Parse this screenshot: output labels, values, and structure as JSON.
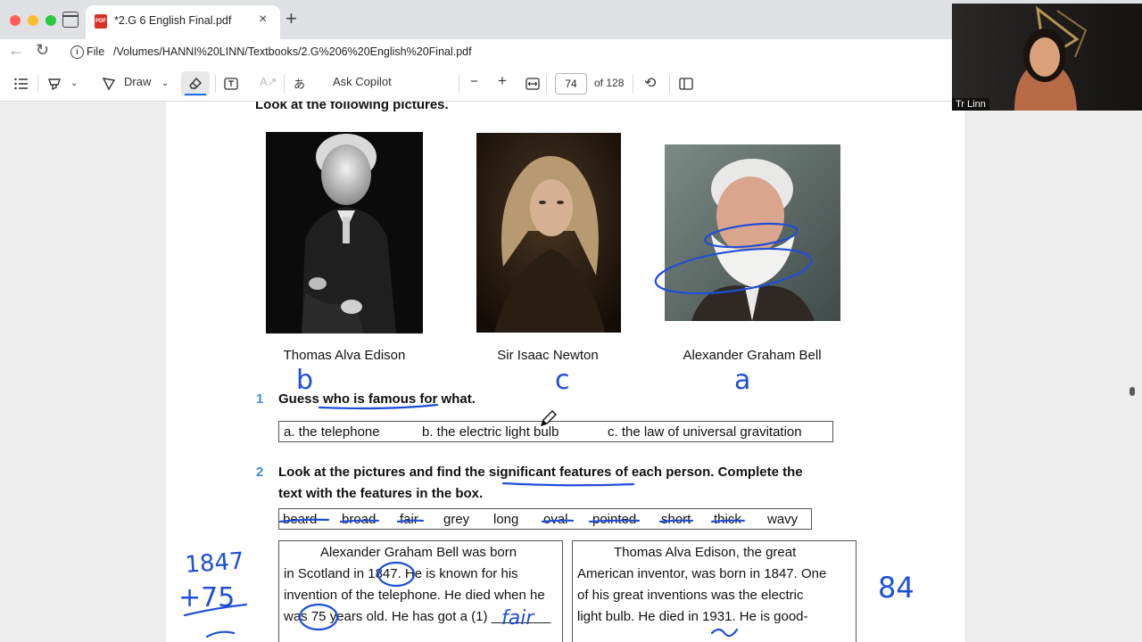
{
  "browser": {
    "tab_title": "*2.G 6 English Final.pdf",
    "tab_close": "×",
    "new_tab": "+",
    "file_label": "File",
    "url": "/Volumes/HANNI%20LINN/Textbooks/2.G%206%20English%20Final.pdf"
  },
  "pdf_toolbar": {
    "draw_label": "Draw",
    "ask_copilot": "Ask Copilot",
    "zoom_out": "−",
    "zoom_in": "+",
    "page_current": "74",
    "page_total": "of 128"
  },
  "page": {
    "intro": "Look at the following pictures.",
    "people": [
      {
        "name": "Thomas Alva Edison",
        "handwritten": "b"
      },
      {
        "name": "Sir Isaac Newton",
        "handwritten": "c"
      },
      {
        "name": "Alexander Graham Bell",
        "handwritten": "a"
      }
    ],
    "q1": {
      "number": "1",
      "text": "Guess who is famous for what."
    },
    "answers": [
      "a. the telephone",
      "b.  the electric light bulb",
      "c. the law of universal gravitation"
    ],
    "q2": {
      "number": "2",
      "line1": "Look at the pictures and find the significant features of each person. Complete the",
      "line2": "text with the features in the box."
    },
    "words": [
      "beard",
      "broad",
      "fair",
      "grey",
      "long",
      "oval",
      "pointed",
      "short",
      "thick",
      "wavy"
    ],
    "bell_text": [
      "Alexander  Graham  Bell  was  born",
      "in  Scotland  in  1847.  He  is  known  for  his",
      "invention of the telephone. He died when he",
      "was 75 years old. He has got a (1) ________"
    ],
    "edison_text": [
      "Thomas Alva Edison, the great",
      "American inventor, was born in 1847. One",
      "of his great inventions was the electric",
      "light bulb. He died in 1931. He is good-"
    ],
    "handwriting": {
      "blank1": "fair",
      "side_a": "1847",
      "side_b": "+75",
      "side_c": "84"
    }
  },
  "webcam": {
    "name": "Tr Linn"
  }
}
